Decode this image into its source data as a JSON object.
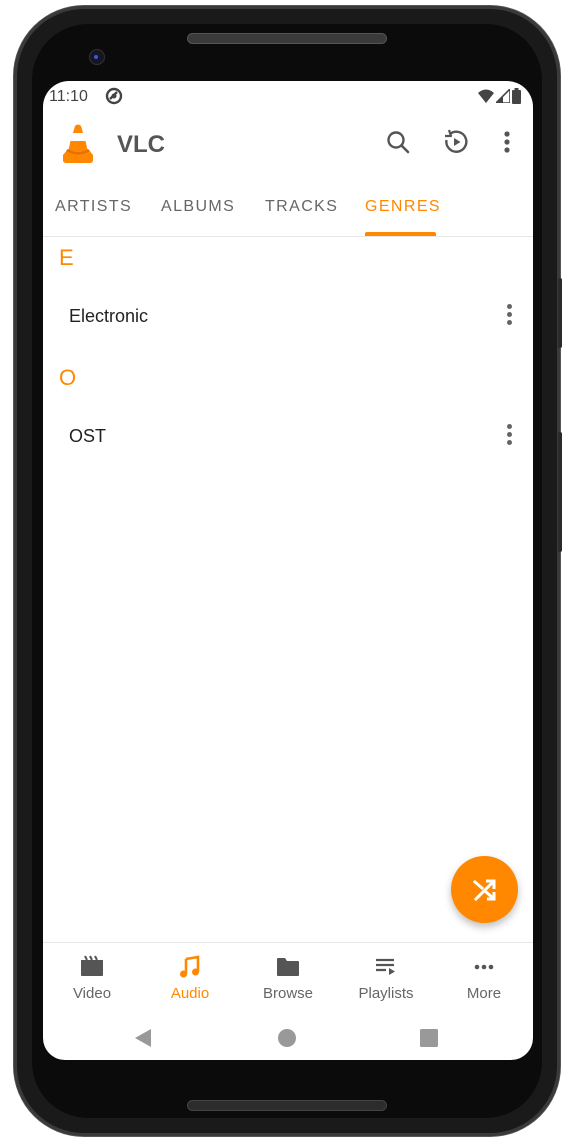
{
  "status_bar": {
    "time": "11:10",
    "icons": [
      "sync-icon",
      "wifi-icon",
      "cell-signal-icon",
      "battery-icon"
    ]
  },
  "app_bar": {
    "title": "VLC",
    "logo": "vlc-cone-icon",
    "actions": [
      {
        "name": "search",
        "icon": "search-icon"
      },
      {
        "name": "resume-playback",
        "icon": "history-play-icon"
      },
      {
        "name": "overflow-menu",
        "icon": "more-vert-icon"
      }
    ]
  },
  "tabs": [
    {
      "label": "ARTISTS",
      "active": false
    },
    {
      "label": "ALBUMS",
      "active": false
    },
    {
      "label": "TRACKS",
      "active": false
    },
    {
      "label": "GENRES",
      "active": true
    }
  ],
  "sections": [
    {
      "letter": "E",
      "items": [
        {
          "name": "Electronic"
        }
      ]
    },
    {
      "letter": "O",
      "items": [
        {
          "name": "OST"
        }
      ]
    }
  ],
  "fab": {
    "icon": "shuffle-icon",
    "label": "Shuffle all"
  },
  "bottom_nav": [
    {
      "label": "Video",
      "icon": "movie-clapper-icon",
      "active": false
    },
    {
      "label": "Audio",
      "icon": "music-note-icon",
      "active": true
    },
    {
      "label": "Browse",
      "icon": "folder-icon",
      "active": false
    },
    {
      "label": "Playlists",
      "icon": "playlist-play-icon",
      "active": false
    },
    {
      "label": "More",
      "icon": "more-horiz-icon",
      "active": false
    }
  ],
  "system_nav": [
    "back",
    "home",
    "recents"
  ],
  "colors": {
    "accent": "#ff8800",
    "text_primary": "#222222",
    "text_secondary": "#666666",
    "frame": "#1a1a1a"
  }
}
